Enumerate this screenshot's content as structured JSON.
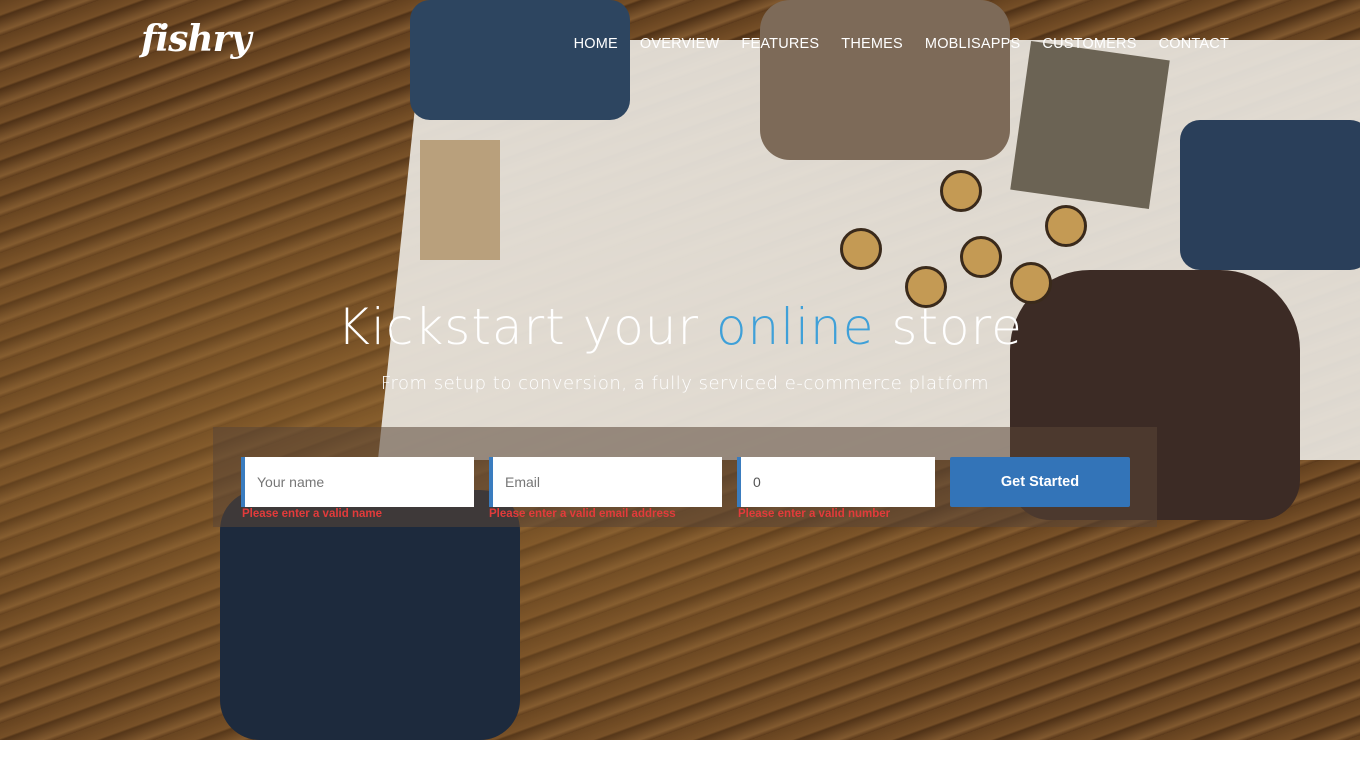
{
  "brand": {
    "logo_text": "fishry"
  },
  "nav": {
    "items": [
      {
        "label": "HOME"
      },
      {
        "label": "OVERVIEW"
      },
      {
        "label": "FEATURES"
      },
      {
        "label": "THEMES"
      },
      {
        "label": "MOBLISAPPS"
      },
      {
        "label": "CUSTOMERS"
      },
      {
        "label": "CONTACT"
      }
    ]
  },
  "hero": {
    "headline_before": "Kickstart your ",
    "headline_accent": "online",
    "headline_after": " store",
    "subheadline": "From setup to conversion, a fully serviced e-commerce platform",
    "accent_color": "#3fa0d8"
  },
  "form": {
    "name_placeholder": "Your name",
    "email_placeholder": "Email",
    "number_value": "0",
    "name_error": "Please enter a valid name",
    "email_error": "Please enter a valid email address",
    "number_error": "Please enter a valid number",
    "submit_label": "Get Started",
    "button_color": "#3374b8",
    "error_color": "#e23b3b"
  }
}
